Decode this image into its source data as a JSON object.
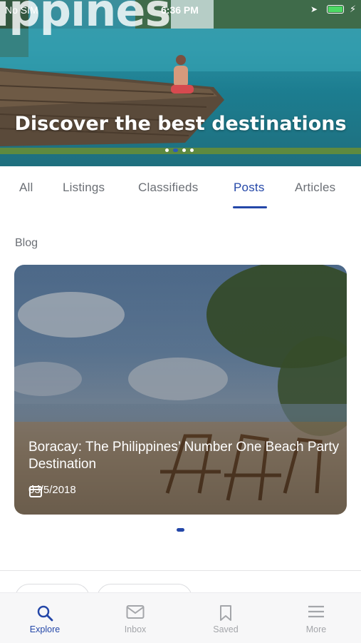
{
  "status_bar": {
    "carrier": "No SIM",
    "time": "6:36 PM"
  },
  "hero": {
    "brand_text": "ippines",
    "title": "Discover the best destinations",
    "carousel_dots": 3,
    "active_dot": 2
  },
  "tabs": [
    {
      "label": "All"
    },
    {
      "label": "Listings"
    },
    {
      "label": "Classifieds"
    },
    {
      "label": "Posts",
      "active": true
    },
    {
      "label": "Articles"
    }
  ],
  "blog": {
    "section_label": "Blog",
    "card": {
      "title": "Boracay: The Philippines’ Number One Beach Party Destination",
      "date": "03/5/2018"
    }
  },
  "bottom_nav": [
    {
      "label": "Explore",
      "icon": "search-icon",
      "active": true
    },
    {
      "label": "Inbox",
      "icon": "mail-icon"
    },
    {
      "label": "Saved",
      "icon": "bookmark-icon"
    },
    {
      "label": "More",
      "icon": "menu-icon"
    }
  ],
  "colors": {
    "accent": "#2447a8",
    "inactive": "#a4a6aa",
    "tab_text": "#6b6f75",
    "battery": "#4cd964"
  }
}
